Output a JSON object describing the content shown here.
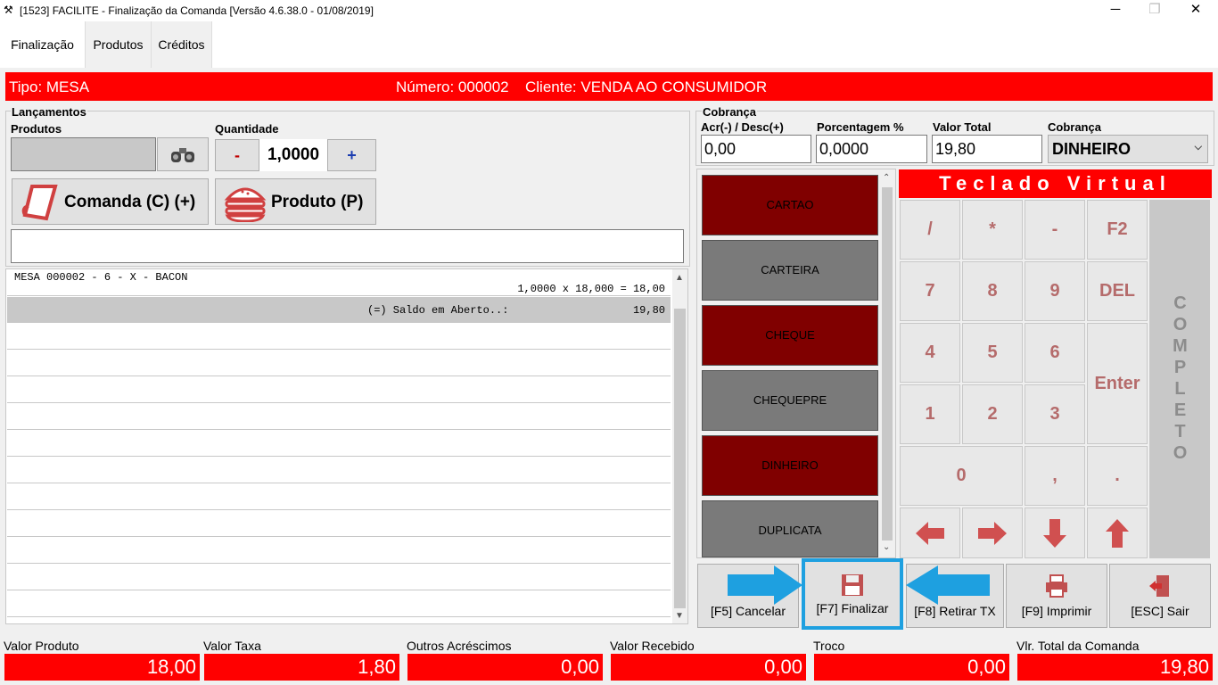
{
  "window": {
    "title": "[1523] FACILITE - Finalização da Comanda [Versão 4.6.38.0 - 01/08/2019]",
    "minimize": "─",
    "maximize": "❐",
    "close": "✕"
  },
  "tabs": [
    {
      "label": "Finalização"
    },
    {
      "label": "Produtos"
    },
    {
      "label": "Créditos"
    }
  ],
  "banner": {
    "tipo": "Tipo: MESA",
    "numero": "Número: 000002",
    "cliente": "Cliente: VENDA AO CONSUMIDOR"
  },
  "lancamentos": {
    "group_label": "Lançamentos",
    "produtos_label": "Produtos",
    "quantidade_label": "Quantidade",
    "minus": "-",
    "quantity": "1,0000",
    "plus": "+",
    "comanda_button": "Comanda (C) (+)",
    "produto_button": "Produto (P)"
  },
  "list": {
    "item_desc": "MESA 000002 - 6 - X - BACON",
    "item_calc": "1,0000 x 18,000 = 18,00",
    "saldo_label": "(=) Saldo em Aberto..:",
    "saldo_value": "19,80"
  },
  "cobranca": {
    "group_label": "Cobrança",
    "acr_label": "Acr(-) / Desc(+)",
    "acr_value": "0,00",
    "pct_label": "Porcentagem %",
    "pct_value": "0,0000",
    "total_label": "Valor Total",
    "total_value": "19,80",
    "type_label": "Cobrança",
    "type_value": "DINHEIRO"
  },
  "payments": [
    {
      "label": "CARTAO",
      "color": "#800000"
    },
    {
      "label": "CARTEIRA",
      "color": "#7a7a7a"
    },
    {
      "label": "CHEQUE",
      "color": "#800000"
    },
    {
      "label": "CHEQUEPRE",
      "color": "#7a7a7a"
    },
    {
      "label": "DINHEIRO",
      "color": "#800000"
    },
    {
      "label": "DUPLICATA",
      "color": "#7a7a7a"
    }
  ],
  "keypad": {
    "title": "Teclado Virtual",
    "keys": [
      "/",
      "*",
      "-",
      "F2",
      "7",
      "8",
      "9",
      "DEL",
      "4",
      "5",
      "6",
      "Enter",
      "1",
      "2",
      "3",
      "0",
      ",",
      "."
    ],
    "completo": "COMPLETO"
  },
  "actions": {
    "cancelar": "[F5] Cancelar",
    "finalizar": "[F7] Finalizar",
    "retirar": "[F8] Retirar TX",
    "imprimir": "[F9] Imprimir",
    "sair": "[ESC] Sair"
  },
  "totals": [
    {
      "label": "Valor Produto",
      "value": "18,00"
    },
    {
      "label": "Valor Taxa",
      "value": "1,80"
    },
    {
      "label": "Outros Acréscimos",
      "value": "0,00"
    },
    {
      "label": "Valor Recebido",
      "value": "0,00"
    },
    {
      "label": "Troco",
      "value": "0,00"
    },
    {
      "label": "Vlr. Total da Comanda",
      "value": "19,80"
    }
  ],
  "colors": {
    "accent_red": "#ff0000",
    "highlight_blue": "#1ea0e0"
  }
}
